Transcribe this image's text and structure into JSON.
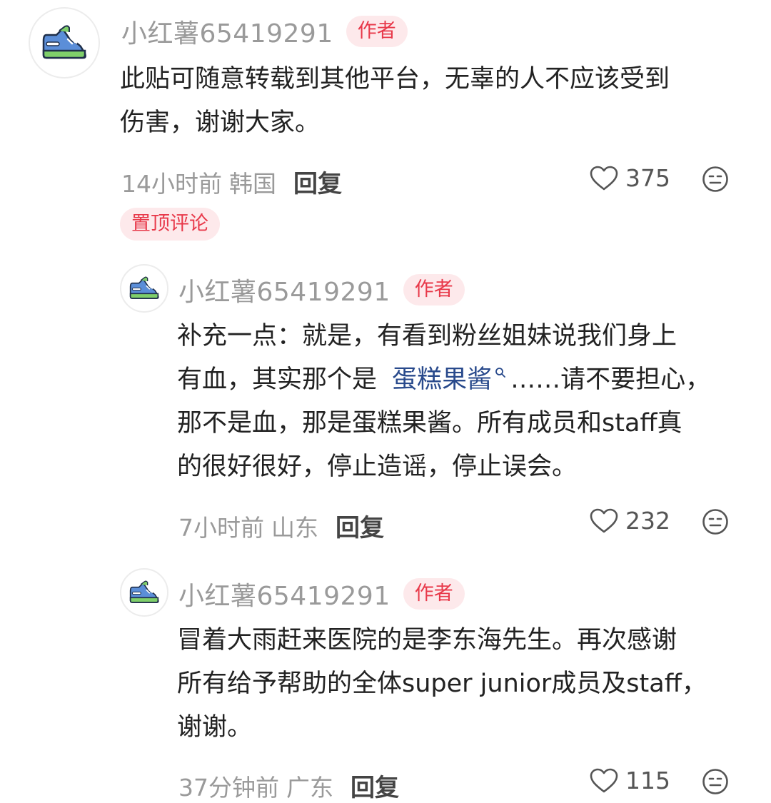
{
  "comments": [
    {
      "username": "小红薯65419291",
      "author_badge": "作者",
      "content_lines": [
        "此贴可随意转载到其他平台，无辜的人不应该受到",
        "伤害，谢谢大家。"
      ],
      "time": "14小时前",
      "location": "韩国",
      "reply_label": "回复",
      "like_count": "375",
      "pinned_label": "置顶评论"
    },
    {
      "username": "小红薯65419291",
      "author_badge": "作者",
      "content_line1": "补充一点：就是，有看到粉丝姐妹说我们身上",
      "content_line2_before": "有血，其实那个是",
      "content_line2_link": "蛋糕果酱",
      "content_line2_after": "……请不要担心，",
      "content_line3": "那不是血，那是蛋糕果酱。所有成员和staff真",
      "content_line4": "的很好很好，停止造谣，停止误会。",
      "time": "7小时前",
      "location": "山东",
      "reply_label": "回复",
      "like_count": "232"
    },
    {
      "username": "小红薯65419291",
      "author_badge": "作者",
      "content_lines": [
        "冒着大雨赶来医院的是李东海先生。再次感谢",
        "所有给予帮助的全体super junior成员及staff，",
        "谢谢。"
      ],
      "time": "37分钟前",
      "location": "广东",
      "reply_label": "回复",
      "like_count": "115"
    }
  ],
  "colors": {
    "username": "#9a9a9a",
    "badge_bg": "#fde9eb",
    "badge_text": "#e8394a",
    "link": "#294a8c",
    "body_text": "#222222"
  },
  "icons": {
    "avatar": "sneaker-icon",
    "like": "heart-outline-icon",
    "emoji": "neutral-face-icon",
    "link": "search-icon"
  }
}
